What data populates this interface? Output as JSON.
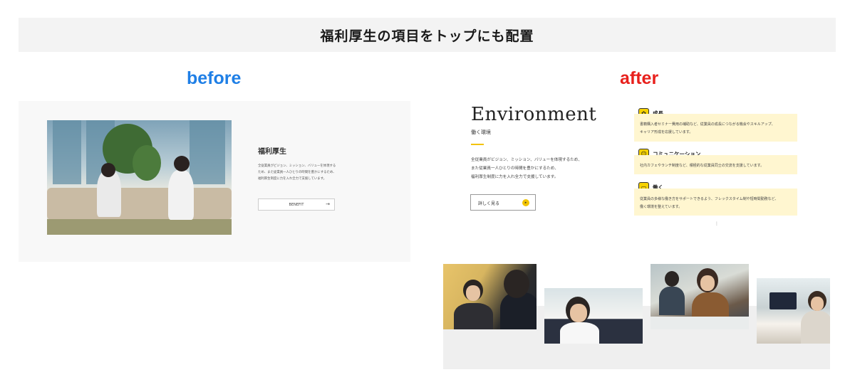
{
  "banner": {
    "title": "福利厚生の項目をトップにも配置"
  },
  "labels": {
    "before": "before",
    "after": "after",
    "before_color": "#1f7fe6",
    "after_color": "#e8201c"
  },
  "before": {
    "title": "福利厚生",
    "body": "全従業員がビジョン、ミッション、バリューを体現するため、また従業員一人ひとりの時間を豊かにするため、福利厚生制度に力を入れ全力で支援しています。",
    "button_label": "BENEFIT",
    "button_arrow": "→"
  },
  "after": {
    "heading": "Environment",
    "subheading": "働く環境",
    "body_lines": [
      "全従業員がビジョン、ミッション、バリューを体現するため、",
      "また従業員一人ひとりの時間を豊かにするため、",
      "福利厚生制度に力を入れ全力で支援しています。"
    ],
    "button_label": "詳しく見る",
    "button_icon": "▸",
    "accent_color": "#f3c300",
    "cards": [
      {
        "title": "成長",
        "icon": "growth-icon",
        "lines": [
          "書籍購入者セミナー費用の補助など、従業員の成長につながる機会やスキルアップ、",
          "キャリア形成を応援しています。"
        ]
      },
      {
        "title": "コミュニケーション",
        "icon": "communication-icon",
        "lines": [
          "社内カフェやランチ制度など、積極的な従業員同士の交流を支援しています。"
        ]
      },
      {
        "title": "働く",
        "icon": "work-icon",
        "lines": [
          "従業員の多様な働き方をサポートできるよう、フレックスタイム制や短時間勤務など、",
          "働く環境を整えています。"
        ]
      }
    ],
    "more_indicator": "⋮"
  }
}
